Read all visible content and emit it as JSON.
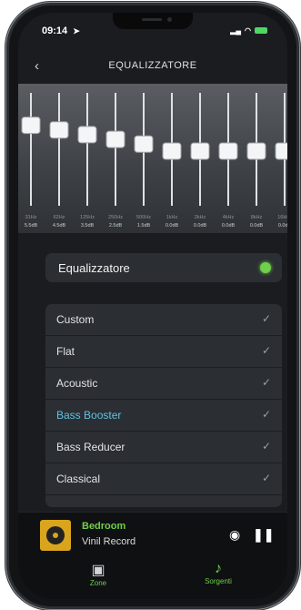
{
  "status_bar": {
    "time": "09:14",
    "location_arrow": "location-arrow-icon"
  },
  "nav": {
    "back": "‹",
    "title": "EQUALIZZATORE"
  },
  "equalizer": {
    "bands": [
      {
        "freq": "31Hz",
        "gain": "5.5dB"
      },
      {
        "freq": "62Hz",
        "gain": "4.5dB"
      },
      {
        "freq": "125Hz",
        "gain": "3.5dB"
      },
      {
        "freq": "250Hz",
        "gain": "2.5dB"
      },
      {
        "freq": "500Hz",
        "gain": "1.5dB"
      },
      {
        "freq": "1kHz",
        "gain": "0.0dB"
      },
      {
        "freq": "2kHz",
        "gain": "0.0dB"
      },
      {
        "freq": "4kHz",
        "gain": "0.0dB"
      },
      {
        "freq": "8kHz",
        "gain": "0.0dB"
      },
      {
        "freq": "16kHz",
        "gain": "0.0dB"
      }
    ]
  },
  "eq_toggle": {
    "label": "Equalizzatore",
    "enabled": true
  },
  "presets": [
    {
      "name": "Custom",
      "active": false
    },
    {
      "name": "Flat",
      "active": false
    },
    {
      "name": "Acoustic",
      "active": false
    },
    {
      "name": "Bass Booster",
      "active": true
    },
    {
      "name": "Bass Reducer",
      "active": false
    },
    {
      "name": "Classical",
      "active": false
    }
  ],
  "player": {
    "room": "Bedroom",
    "track": "Vinil Record"
  },
  "tabs": {
    "zones": "Zone",
    "sources": "Sorgenti"
  },
  "colors": {
    "accent_green": "#6fd049",
    "active_blue": "#5fc3e3"
  }
}
